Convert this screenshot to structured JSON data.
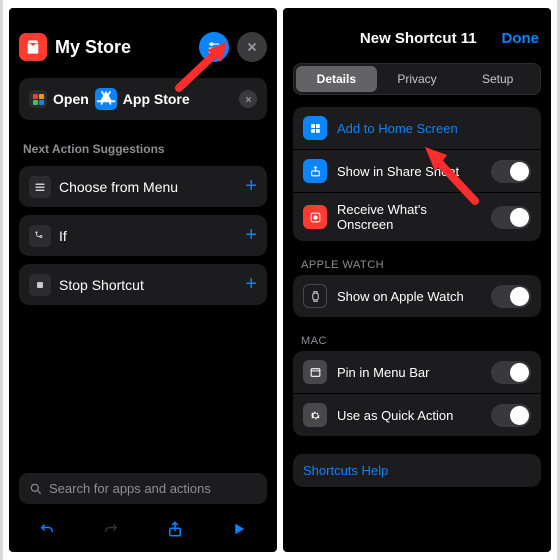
{
  "left": {
    "title": "My Store",
    "open_text": "Open",
    "open_target": "App Store",
    "suggestions_header": "Next Action Suggestions",
    "suggestions": [
      {
        "label": "Choose from Menu"
      },
      {
        "label": "If"
      },
      {
        "label": "Stop Shortcut"
      }
    ],
    "search_placeholder": "Search for apps and actions"
  },
  "right": {
    "title": "New Shortcut 11",
    "done": "Done",
    "tabs": {
      "details": "Details",
      "privacy": "Privacy",
      "setup": "Setup"
    },
    "main": {
      "add_home": "Add to Home Screen",
      "share_sheet": "Show in Share Sheet",
      "onscreen": "Receive What's Onscreen"
    },
    "watch_header": "APPLE WATCH",
    "watch": {
      "show": "Show on Apple Watch"
    },
    "mac_header": "MAC",
    "mac": {
      "pin": "Pin in Menu Bar",
      "quick": "Use as Quick Action"
    },
    "help": "Shortcuts Help"
  }
}
